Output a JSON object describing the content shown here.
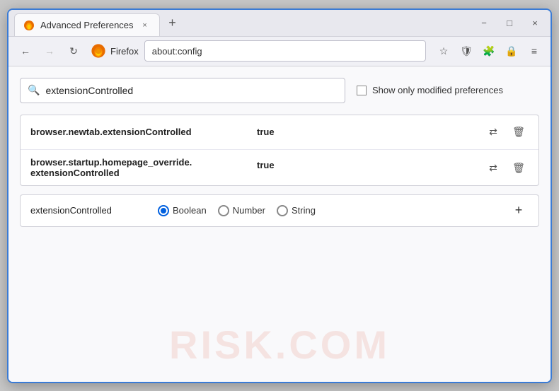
{
  "window": {
    "title": "Advanced Preferences",
    "tab_close_label": "×",
    "new_tab_label": "+",
    "minimize_label": "−",
    "maximize_label": "□",
    "close_label": "×"
  },
  "nav": {
    "back_label": "←",
    "forward_label": "→",
    "refresh_label": "↻",
    "firefox_label": "Firefox",
    "address": "about:config",
    "bookmark_icon": "☆",
    "shield_icon": "🛡",
    "extension_icon": "🧩",
    "lock_icon": "🔒",
    "menu_icon": "≡"
  },
  "search": {
    "value": "extensionControlled",
    "placeholder": "extensionControlled",
    "show_modified_label": "Show only modified preferences"
  },
  "results": [
    {
      "name": "browser.newtab.extensionControlled",
      "value": "true"
    },
    {
      "name": "browser.startup.homepage_override.\nextensionControlled",
      "name_line1": "browser.startup.homepage_override.",
      "name_line2": "extensionControlled",
      "value": "true",
      "multiline": true
    }
  ],
  "new_pref": {
    "name": "extensionControlled",
    "types": [
      {
        "label": "Boolean",
        "selected": true
      },
      {
        "label": "Number",
        "selected": false
      },
      {
        "label": "String",
        "selected": false
      }
    ],
    "add_label": "+"
  },
  "watermark": "RISK.COM",
  "colors": {
    "accent": "#3a7bd5",
    "radio_selected": "#0060df"
  }
}
